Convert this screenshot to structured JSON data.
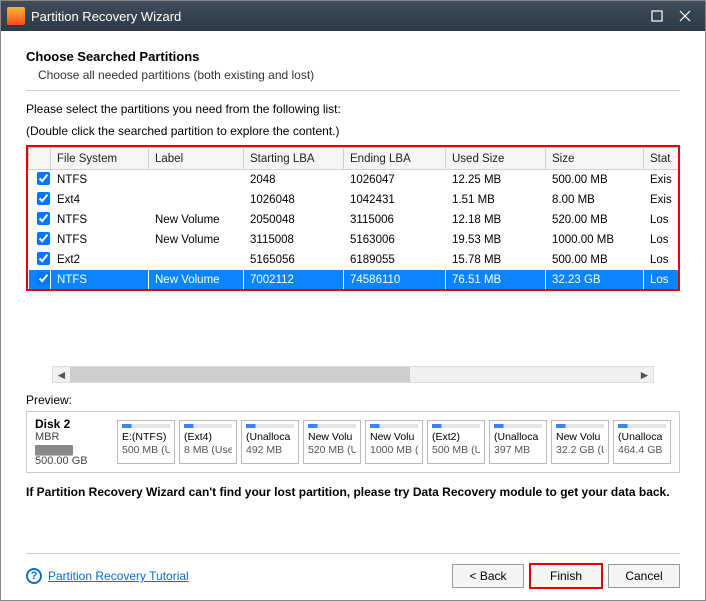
{
  "window": {
    "title": "Partition Recovery Wizard"
  },
  "header": {
    "heading": "Choose Searched Partitions",
    "sub": "Choose all needed partitions (both existing and lost)"
  },
  "instructions": {
    "line1": "Please select the partitions you need from the following list:",
    "line2": "(Double click the searched partition to explore the content.)"
  },
  "columns": {
    "fs": "File System",
    "label": "Label",
    "start": "Starting LBA",
    "end": "Ending LBA",
    "used": "Used Size",
    "size": "Size",
    "status": "Stat"
  },
  "rows": [
    {
      "checked": true,
      "fs": "NTFS",
      "label": "",
      "start": "2048",
      "end": "1026047",
      "used": "12.25 MB",
      "size": "500.00 MB",
      "status": "Exis",
      "selected": false
    },
    {
      "checked": true,
      "fs": "Ext4",
      "label": "",
      "start": "1026048",
      "end": "1042431",
      "used": "1.51 MB",
      "size": "8.00 MB",
      "status": "Exis",
      "selected": false
    },
    {
      "checked": true,
      "fs": "NTFS",
      "label": "New Volume",
      "start": "2050048",
      "end": "3115006",
      "used": "12.18 MB",
      "size": "520.00 MB",
      "status": "Los",
      "selected": false
    },
    {
      "checked": true,
      "fs": "NTFS",
      "label": "New Volume",
      "start": "3115008",
      "end": "5163006",
      "used": "19.53 MB",
      "size": "1000.00 MB",
      "status": "Los",
      "selected": false
    },
    {
      "checked": true,
      "fs": "Ext2",
      "label": "",
      "start": "5165056",
      "end": "6189055",
      "used": "15.78 MB",
      "size": "500.00 MB",
      "status": "Los",
      "selected": false
    },
    {
      "checked": true,
      "fs": "NTFS",
      "label": "New Volume",
      "start": "7002112",
      "end": "74586110",
      "used": "76.51 MB",
      "size": "32.23 GB",
      "status": "Los",
      "selected": true
    }
  ],
  "preview": {
    "label": "Preview:",
    "disk": {
      "name": "Disk 2",
      "type": "MBR",
      "capacity": "500.00 GB"
    },
    "chips": [
      {
        "name": "E:(NTFS)",
        "size": "500 MB (U"
      },
      {
        "name": "(Ext4)",
        "size": "8 MB (Use"
      },
      {
        "name": "(Unalloca",
        "size": "492 MB"
      },
      {
        "name": "New Volu",
        "size": "520 MB (U"
      },
      {
        "name": "New Volu",
        "size": "1000 MB ("
      },
      {
        "name": "(Ext2)",
        "size": "500 MB (U"
      },
      {
        "name": "(Unalloca",
        "size": "397 MB"
      },
      {
        "name": "New Volu",
        "size": "32.2 GB (U"
      },
      {
        "name": "(Unalloca",
        "size": "464.4 GB"
      }
    ]
  },
  "note": "If Partition Recovery Wizard can't find your lost partition, please try Data Recovery module to get your data back.",
  "footer": {
    "tutorial": "Partition Recovery Tutorial",
    "back": "< Back",
    "finish": "Finish",
    "cancel": "Cancel"
  }
}
